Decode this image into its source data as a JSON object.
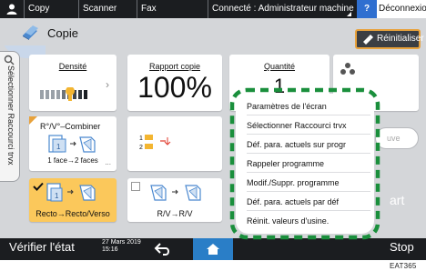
{
  "topbar": {
    "tabs": [
      "Copy",
      "Scanner",
      "Fax"
    ],
    "status": "Connecté : Administrateur machine",
    "help": "?",
    "logout": "Déconnexion"
  },
  "header": {
    "title": "Copie",
    "reset_label": "Réinitialiser"
  },
  "shortcut_tab": {
    "label": "Sélectionner Raccourci trvx"
  },
  "tiles": {
    "density": {
      "label": "Densité"
    },
    "ratio": {
      "label": "Rapport copie",
      "value": "100%"
    },
    "quantity": {
      "label": "Quantité",
      "value": "1"
    },
    "combine": {
      "label": "R°/V°–Combiner",
      "sub": "1 face→2 faces",
      "more": "..."
    },
    "duplex": {
      "label": "Recto→Recto/Verso"
    },
    "rv": {
      "label": "R/V→R/V"
    },
    "ghost_button": "uve",
    "start": "art"
  },
  "menu": {
    "items": [
      "Paramètres de l'écran",
      "Sélectionner Raccourci trvx",
      "Déf. para. actuels sur progr",
      "Rappeler programme",
      "Modif./Suppr. programme",
      "Déf. para. actuels par déf",
      "Réinit. valeurs d'usine."
    ]
  },
  "bottombar": {
    "check_status": "Vérifier l'état",
    "date": "27 Mars 2019",
    "time": "15:16",
    "stop": "Stop"
  },
  "figure_id": "EAT365",
  "colors": {
    "accent_orange": "#e8a23c",
    "menu_border_green": "#1a8f3c",
    "home_blue": "#2a7ec7",
    "help_blue": "#2f6fd0",
    "duplex_yellow": "#fbc85b"
  }
}
